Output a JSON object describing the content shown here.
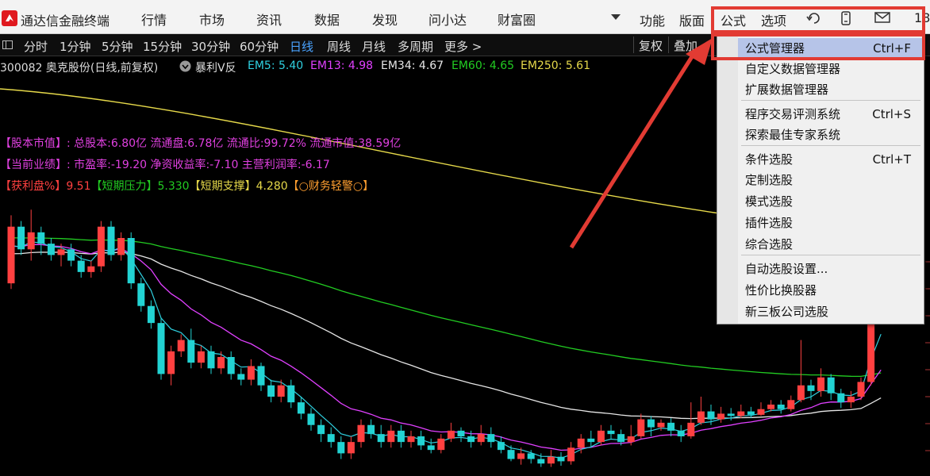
{
  "app": {
    "title": "通达信金融终端"
  },
  "menu": [
    "行情",
    "市场",
    "资讯",
    "数据",
    "发现",
    "问小达",
    "财富圈"
  ],
  "right_menu": {
    "func": "功能",
    "layout": "版面",
    "formula": "公式",
    "options": "选项",
    "cut_text": "18"
  },
  "toolbar": {
    "periods": [
      "分时",
      "1分钟",
      "5分钟",
      "15分钟",
      "30分钟",
      "60分钟",
      "日线",
      "周线",
      "月线",
      "多周期",
      "更多 >"
    ],
    "active_period": "日线",
    "restore": "复权",
    "overlay": "叠加"
  },
  "stock": {
    "name": "300082 奥克股份(日线,前复权)",
    "indicator": "暴利V反",
    "em5": "EM5: 5.40",
    "em13": "EM13: 4.98",
    "em34": "EM34: 4.67",
    "em60": "EM60: 4.65",
    "em250": "EM250: 5.61"
  },
  "info": {
    "line1": "【股本市值】: 总股本:6.80亿 流通盘:6.78亿 流通比:99.72% 流通市值:38.59亿",
    "line2": "【当前业绩】: 市盈率:-19.20 净资收益率:-7.10 主营利润率:-6.17",
    "line3_a": "【获利盘%】",
    "line3_a_val": "9.51",
    "line3_b": "【短期压力】",
    "line3_b_val": "5.330",
    "line3_c": "【短期支撑】",
    "line3_c_val": "4.280",
    "line3_d": "【○财务轻警○】"
  },
  "dropdown": [
    {
      "label": "公式管理器",
      "shortcut": "Ctrl+F",
      "selected": true
    },
    {
      "label": "自定义数据管理器",
      "shortcut": ""
    },
    {
      "label": "扩展数据管理器",
      "shortcut": ""
    },
    {
      "label": "程序交易评测系统",
      "shortcut": "Ctrl+S"
    },
    {
      "label": "探索最佳专家系统",
      "shortcut": ""
    },
    {
      "label": "条件选股",
      "shortcut": "Ctrl+T"
    },
    {
      "label": "定制选股",
      "shortcut": ""
    },
    {
      "label": "模式选股",
      "shortcut": ""
    },
    {
      "label": "插件选股",
      "shortcut": ""
    },
    {
      "label": "综合选股",
      "shortcut": ""
    },
    {
      "label": "自动选股设置...",
      "shortcut": ""
    },
    {
      "label": "性价比换股器",
      "shortcut": ""
    },
    {
      "label": "新三板公司选股",
      "shortcut": ""
    }
  ],
  "colors": {
    "em5": "#2fd0e0",
    "em13": "#e040ff",
    "em34": "#e6e6e6",
    "em60": "#22cc22",
    "em250": "#e6d94a",
    "up": "#ff4040",
    "down": "#22d3d3",
    "info_magenta": "#e040e0",
    "annotation": "#e23b33"
  },
  "chart_data": {
    "type": "candlestick",
    "bars": [
      [
        4.95,
        5.45,
        5.55,
        4.9
      ],
      [
        5.45,
        5.25,
        5.5,
        5.2
      ],
      [
        5.25,
        5.4,
        5.6,
        5.15
      ],
      [
        5.4,
        5.3,
        5.45,
        5.2
      ],
      [
        5.3,
        5.2,
        5.35,
        5.15
      ],
      [
        5.2,
        5.25,
        5.3,
        5.1
      ],
      [
        5.25,
        5.15,
        5.3,
        5.1
      ],
      [
        5.15,
        5.05,
        5.2,
        5.0
      ],
      [
        5.05,
        5.1,
        5.15,
        5.0
      ],
      [
        5.1,
        5.45,
        5.5,
        5.05
      ],
      [
        5.45,
        5.2,
        5.5,
        5.15
      ],
      [
        5.2,
        5.35,
        5.4,
        5.15
      ],
      [
        5.35,
        4.95,
        5.4,
        4.9
      ],
      [
        4.95,
        4.75,
        5.0,
        4.7
      ],
      [
        4.75,
        4.6,
        4.8,
        4.55
      ],
      [
        4.6,
        4.15,
        4.65,
        4.1
      ],
      [
        4.15,
        4.35,
        4.4,
        4.05
      ],
      [
        4.35,
        4.45,
        4.5,
        4.3
      ],
      [
        4.45,
        4.25,
        4.55,
        4.2
      ],
      [
        4.25,
        4.35,
        4.4,
        4.2
      ],
      [
        4.35,
        4.2,
        4.4,
        4.15
      ],
      [
        4.2,
        4.3,
        4.35,
        4.15
      ],
      [
        4.3,
        4.15,
        4.35,
        4.1
      ],
      [
        4.15,
        4.1,
        4.2,
        4.05
      ],
      [
        4.1,
        4.22,
        4.28,
        4.05
      ],
      [
        4.22,
        4.05,
        4.25,
        4.0
      ],
      [
        4.05,
        3.95,
        4.1,
        3.9
      ],
      [
        3.95,
        4.05,
        4.1,
        3.9
      ],
      [
        4.05,
        3.9,
        4.1,
        3.85
      ],
      [
        3.9,
        3.8,
        3.95,
        3.75
      ],
      [
        3.8,
        3.7,
        3.85,
        3.65
      ],
      [
        3.7,
        3.62,
        3.75,
        3.55
      ],
      [
        3.62,
        3.55,
        3.68,
        3.5
      ],
      [
        3.55,
        3.45,
        3.6,
        3.4
      ],
      [
        3.45,
        3.55,
        3.6,
        3.4
      ],
      [
        3.55,
        3.7,
        3.75,
        3.5
      ],
      [
        3.7,
        3.62,
        3.75,
        3.58
      ],
      [
        3.62,
        3.55,
        3.7,
        3.5
      ],
      [
        3.55,
        3.65,
        3.7,
        3.5
      ],
      [
        3.65,
        3.55,
        3.7,
        3.5
      ],
      [
        3.55,
        3.6,
        3.65,
        3.5
      ],
      [
        3.6,
        3.52,
        3.65,
        3.48
      ],
      [
        3.52,
        3.48,
        3.58,
        3.45
      ],
      [
        3.48,
        3.58,
        3.62,
        3.45
      ],
      [
        3.58,
        3.65,
        3.72,
        3.55
      ],
      [
        3.65,
        3.6,
        3.68,
        3.55
      ],
      [
        3.6,
        3.55,
        3.65,
        3.5
      ],
      [
        3.55,
        3.62,
        3.7,
        3.52
      ],
      [
        3.62,
        3.55,
        3.68,
        3.5
      ],
      [
        3.55,
        3.48,
        3.6,
        3.45
      ],
      [
        3.48,
        3.4,
        3.52,
        3.38
      ],
      [
        3.4,
        3.45,
        3.5,
        3.35
      ],
      [
        3.45,
        3.4,
        3.48,
        3.36
      ],
      [
        3.4,
        3.36,
        3.45,
        3.33
      ],
      [
        3.36,
        3.42,
        3.48,
        3.33
      ],
      [
        3.42,
        3.38,
        3.46,
        3.34
      ],
      [
        3.38,
        3.5,
        3.55,
        3.35
      ],
      [
        3.5,
        3.58,
        3.62,
        3.45
      ],
      [
        3.58,
        3.55,
        3.65,
        3.5
      ],
      [
        3.55,
        3.65,
        3.7,
        3.52
      ],
      [
        3.65,
        3.62,
        3.7,
        3.58
      ],
      [
        3.62,
        3.55,
        3.66,
        3.52
      ],
      [
        3.55,
        3.6,
        3.7,
        3.52
      ],
      [
        3.6,
        3.75,
        3.8,
        3.58
      ],
      [
        3.75,
        3.68,
        3.78,
        3.6
      ],
      [
        3.68,
        3.72,
        3.75,
        3.65
      ],
      [
        3.72,
        3.65,
        3.76,
        3.6
      ],
      [
        3.65,
        3.6,
        3.7,
        3.55
      ],
      [
        3.6,
        3.72,
        3.9,
        3.58
      ],
      [
        3.72,
        3.82,
        3.95,
        3.7
      ],
      [
        3.82,
        3.75,
        3.88,
        3.7
      ],
      [
        3.75,
        3.8,
        3.86,
        3.72
      ],
      [
        3.8,
        3.78,
        3.85,
        3.74
      ],
      [
        3.78,
        3.82,
        3.88,
        3.76
      ],
      [
        3.82,
        3.79,
        3.86,
        3.76
      ],
      [
        3.79,
        3.84,
        3.9,
        3.78
      ],
      [
        3.84,
        3.88,
        3.92,
        3.82
      ],
      [
        3.88,
        3.84,
        3.92,
        3.8
      ],
      [
        3.84,
        3.92,
        3.96,
        3.82
      ],
      [
        3.92,
        4.05,
        4.45,
        3.9
      ],
      [
        4.05,
        4.0,
        4.1,
        3.92
      ],
      [
        4.0,
        4.12,
        4.2,
        3.95
      ],
      [
        4.12,
        3.98,
        4.15,
        3.92
      ],
      [
        3.98,
        3.9,
        4.02,
        3.85
      ],
      [
        3.9,
        3.95,
        4.0,
        3.85
      ],
      [
        3.95,
        4.08,
        4.12,
        3.92
      ],
      [
        4.08,
        4.85,
        5.05,
        4.05
      ],
      [
        4.85,
        4.95,
        5.2,
        4.7
      ]
    ]
  }
}
